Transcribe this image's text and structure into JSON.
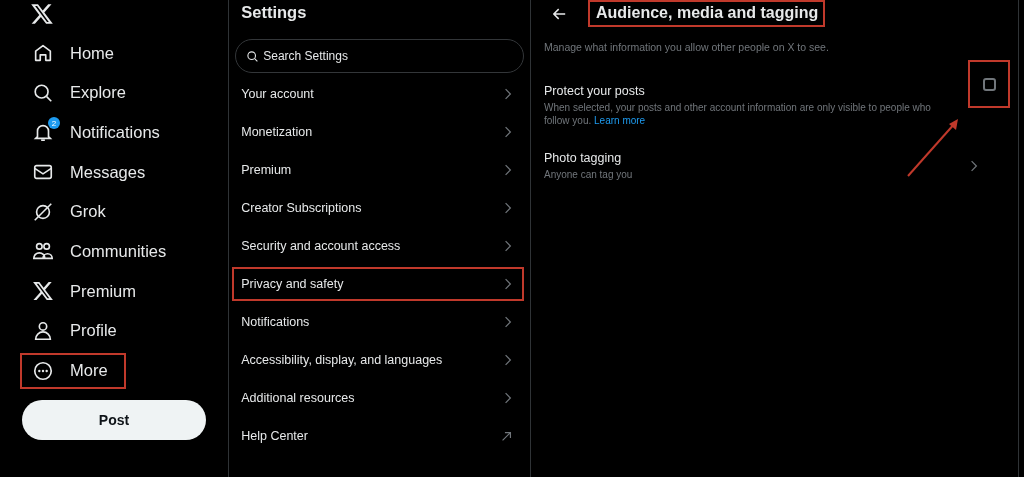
{
  "nav": {
    "items": [
      {
        "label": "Home",
        "highlighted": false
      },
      {
        "label": "Explore",
        "highlighted": false
      },
      {
        "label": "Notifications",
        "badge": "2",
        "highlighted": false
      },
      {
        "label": "Messages",
        "highlighted": false
      },
      {
        "label": "Grok",
        "highlighted": false
      },
      {
        "label": "Communities",
        "highlighted": false
      },
      {
        "label": "Premium",
        "highlighted": false
      },
      {
        "label": "Profile",
        "highlighted": false
      },
      {
        "label": "More",
        "highlighted": true
      }
    ],
    "post_button": "Post"
  },
  "settings": {
    "title": "Settings",
    "search": {
      "placeholder": "Search Settings"
    },
    "items": [
      {
        "label": "Your account",
        "kind": "chevron",
        "highlighted": false
      },
      {
        "label": "Monetization",
        "kind": "chevron",
        "highlighted": false
      },
      {
        "label": "Premium",
        "kind": "chevron",
        "highlighted": false
      },
      {
        "label": "Creator Subscriptions",
        "kind": "chevron",
        "highlighted": false
      },
      {
        "label": "Security and account access",
        "kind": "chevron",
        "highlighted": false
      },
      {
        "label": "Privacy and safety",
        "kind": "chevron",
        "highlighted": true
      },
      {
        "label": "Notifications",
        "kind": "chevron",
        "highlighted": false
      },
      {
        "label": "Accessibility, display, and languages",
        "kind": "chevron",
        "highlighted": false
      },
      {
        "label": "Additional resources",
        "kind": "chevron",
        "highlighted": false
      },
      {
        "label": "Help Center",
        "kind": "external",
        "highlighted": false
      }
    ]
  },
  "detail": {
    "title": "Audience, media and tagging",
    "title_highlighted": true,
    "description": "Manage what information you allow other people on X to see.",
    "protect": {
      "label": "Protect your posts",
      "text": "When selected, your posts and other account information are only visible to people who follow you.",
      "link": "Learn more",
      "checked": false,
      "highlighted": true,
      "arrow": true
    },
    "photo_tagging": {
      "label": "Photo tagging",
      "value": "Anyone can tag you"
    }
  }
}
